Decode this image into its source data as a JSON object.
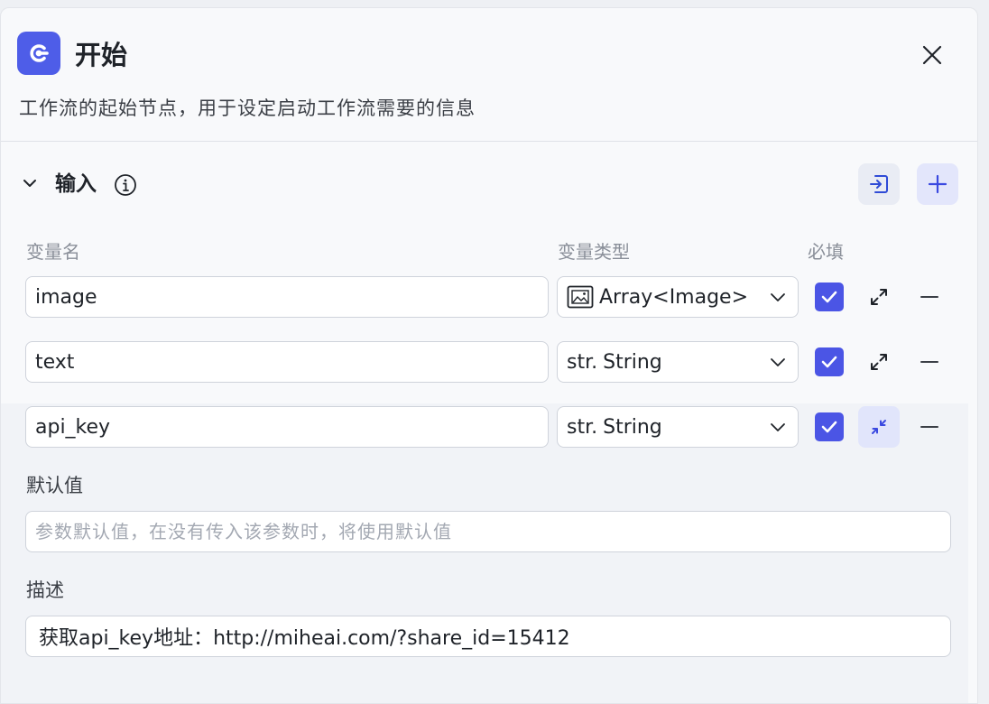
{
  "node": {
    "title": "开始",
    "description": "工作流的起始节点，用于设定启动工作流需要的信息",
    "icon": "start-node-icon"
  },
  "input_section": {
    "title": "输入",
    "columns": {
      "name": "变量名",
      "type": "变量类型",
      "required": "必填"
    },
    "variables": [
      {
        "name": "image",
        "type_prefix": "image-icon",
        "type": "Array<Image>",
        "required": true
      },
      {
        "name": "text",
        "type_prefix": "str.",
        "type": "String",
        "required": true
      },
      {
        "name": "api_key",
        "type_prefix": "str.",
        "type": "String",
        "required": true,
        "expanded": true
      }
    ],
    "expanded_detail": {
      "default_label": "默认值",
      "default_placeholder": "参数默认值，在没有传入该参数时，将使用默认值",
      "default_value": "",
      "desc_label": "描述",
      "desc_value": "获取api_key地址：http://miheai.com/?share_id=15412"
    }
  },
  "colors": {
    "accent": "#4b55e5",
    "node_icon_bg": "#4e5de8"
  }
}
